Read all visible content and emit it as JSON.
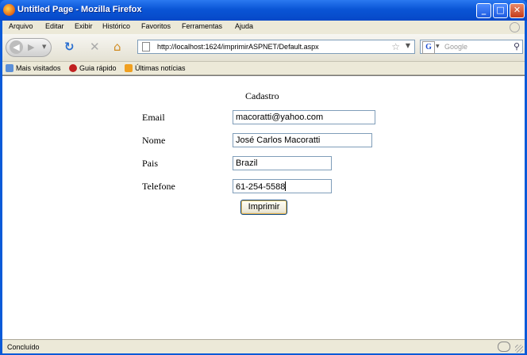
{
  "window": {
    "title": "Untitled Page - Mozilla Firefox",
    "controls": {
      "minimize": "_",
      "maximize": "□",
      "close": "✕"
    }
  },
  "menubar": {
    "items": [
      "Arquivo",
      "Editar",
      "Exibir",
      "Histórico",
      "Favoritos",
      "Ferramentas",
      "Ajuda"
    ]
  },
  "navbar": {
    "url": "http://localhost:1624/imprimirASPNET/Default.aspx",
    "search_placeholder": "Google",
    "icons": [
      "back-icon",
      "forward-icon",
      "reload-icon",
      "stop-icon",
      "home-icon"
    ]
  },
  "bookmarks": {
    "items": [
      {
        "label": "Mais visitados",
        "icon": "folder-icon"
      },
      {
        "label": "Guia rápido",
        "icon": "firefox-help-icon"
      },
      {
        "label": "Últimas notícias",
        "icon": "rss-icon"
      }
    ]
  },
  "form": {
    "heading": "Cadastro",
    "email_label": "Email",
    "email_value": "macoratti@yahoo.com",
    "nome_label": "Nome",
    "nome_value": "José Carlos Macoratti",
    "pais_label": "Pais",
    "pais_value": "Brazil",
    "telefone_label": "Telefone",
    "telefone_value": "61-254-5588",
    "submit_label": "Imprimir"
  },
  "status": {
    "text": "Concluído"
  },
  "colors": {
    "titlebar": "#0a55d6",
    "chrome": "#ece9d8",
    "input_border": "#7f9db9"
  }
}
